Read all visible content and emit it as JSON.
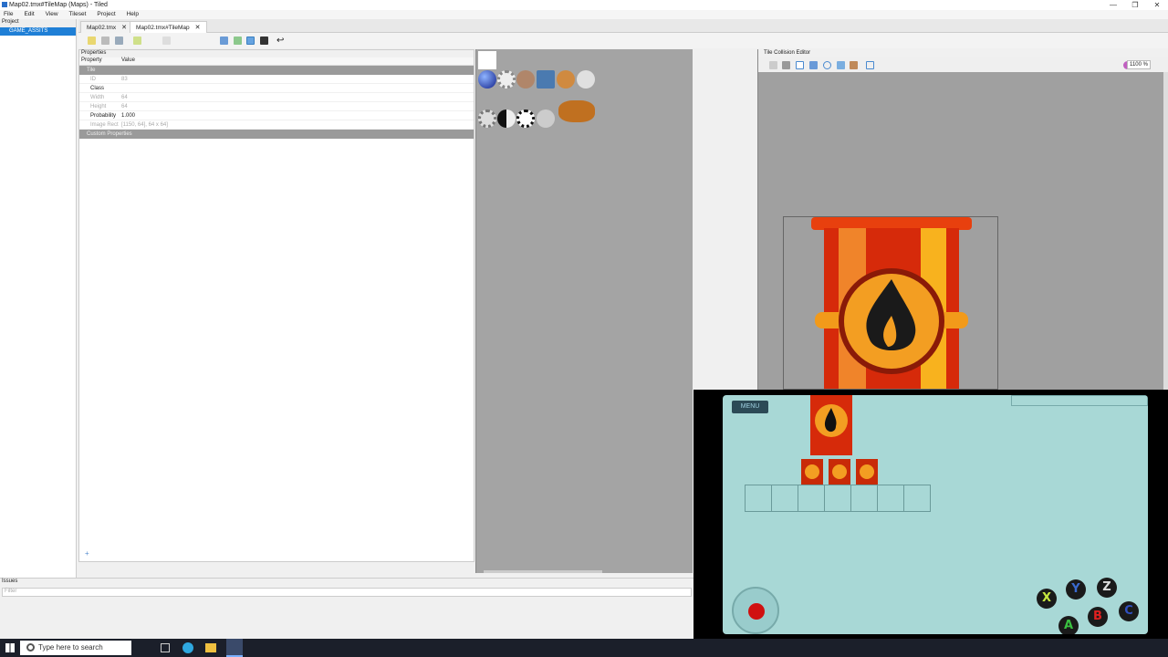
{
  "window": {
    "title": "Map02.tmx#TileMap (Maps) - Tiled",
    "min": "—",
    "max": "❐",
    "close": "✕"
  },
  "menu": [
    "File",
    "Edit",
    "View",
    "Tileset",
    "Project",
    "Help"
  ],
  "project": {
    "header": "Project",
    "selected_item": "GAME_ASSITS"
  },
  "tabs": [
    {
      "label": "Map02.tmx",
      "close": "✕"
    },
    {
      "label": "Map02.tmx#TileMap",
      "close": "✕"
    }
  ],
  "properties": {
    "title": "Properties",
    "col_property": "Property",
    "col_value": "Value",
    "section_tile": "Tile",
    "rows": [
      {
        "key": "ID",
        "value": "83",
        "dim": true
      },
      {
        "key": "Class",
        "value": "",
        "dim": false
      },
      {
        "key": "Width",
        "value": "64",
        "dim": true
      },
      {
        "key": "Height",
        "value": "64",
        "dim": true
      },
      {
        "key": "Probability",
        "value": "1.000",
        "dim": false
      },
      {
        "key": "Image Rect",
        "value": "[1150, 64], 64 x 64]",
        "dim": true
      }
    ],
    "section_custom": "Custom Properties"
  },
  "collision": {
    "title": "Tile Collision Editor",
    "zoom": "1100 %"
  },
  "issues": {
    "label": "Issues",
    "filter_placeholder": "Filter"
  },
  "game": {
    "menu_label": "MENU",
    "buttons": [
      "X",
      "Y",
      "Z",
      "A",
      "B",
      "C"
    ]
  },
  "taskbar": {
    "search_placeholder": "Type here to search"
  },
  "colors": {
    "selection": "#1f7fd6",
    "canvas_gray": "#a0a0a0",
    "game_bg": "#a8d8d6"
  }
}
